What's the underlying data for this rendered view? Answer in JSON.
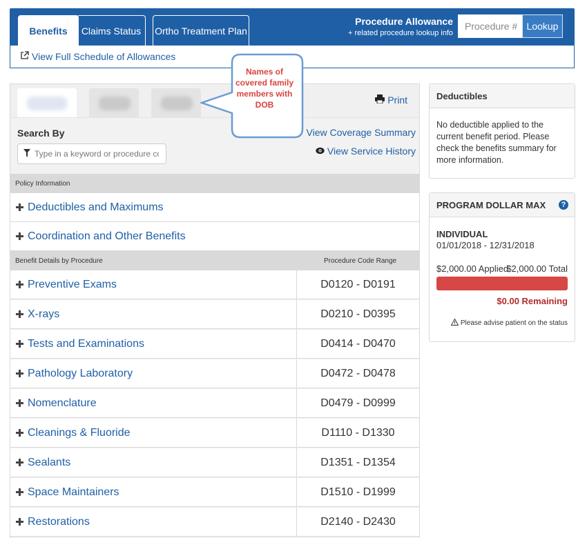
{
  "tabs": [
    {
      "label": "Benefits",
      "active": true
    },
    {
      "label": "Claims Status",
      "active": false
    },
    {
      "label": "Ortho Treatment Plan",
      "active": false
    }
  ],
  "procedure_allowance": {
    "title": "Procedure Allowance",
    "subtitle": "+ related procedure lookup info",
    "input_placeholder": "Procedure #",
    "button_label": "Lookup"
  },
  "schedule_link": "View Full Schedule of Allowances",
  "member_tabs_count": 3,
  "print_label": "Print",
  "search": {
    "label": "Search By",
    "placeholder": "Type in a keyword or procedure code",
    "coverage_link": "View Coverage Summary",
    "history_link": "View Service History"
  },
  "policy_section": {
    "header": "Policy Information",
    "items": [
      "Deductibles and Maximums",
      "Coordination and Other Benefits"
    ]
  },
  "benefit_section": {
    "header": "Benefit Details by Procedure",
    "range_header": "Procedure Code Range",
    "rows": [
      {
        "label": "Preventive Exams",
        "range": "D0120 - D0191"
      },
      {
        "label": "X-rays",
        "range": "D0210 - D0395"
      },
      {
        "label": "Tests and Examinations",
        "range": "D0414 - D0470"
      },
      {
        "label": "Pathology Laboratory",
        "range": "D0472 - D0478"
      },
      {
        "label": "Nomenclature",
        "range": "D0479 - D0999"
      },
      {
        "label": "Cleanings & Fluoride",
        "range": "D1110 - D1330"
      },
      {
        "label": "Sealants",
        "range": "D1351 - D1354"
      },
      {
        "label": "Space Maintainers",
        "range": "D1510 - D1999"
      },
      {
        "label": "Restorations",
        "range": "D2140 - D2430"
      }
    ]
  },
  "deductibles": {
    "title": "Deductibles",
    "text": "No deductible applied to the current benefit period. Please check the benefits summary for more information."
  },
  "program_max": {
    "title": "PROGRAM DOLLAR MAX",
    "help": "?",
    "type": "INDIVIDUAL",
    "period": "01/01/2018 - 12/31/2018",
    "applied": "$2,000.00 Applied",
    "total": "$2,000.00 Total",
    "used_fraction": 1.0,
    "remaining": "$0.00 Remaining",
    "advise": "Please advise patient on the status"
  },
  "callout": {
    "text": "Names of covered family members with DOB"
  },
  "colors": {
    "primary": "#1f5fa6",
    "progress": "#d64745",
    "remaining": "#b22b2b",
    "callout_border": "#6a9bd4"
  }
}
